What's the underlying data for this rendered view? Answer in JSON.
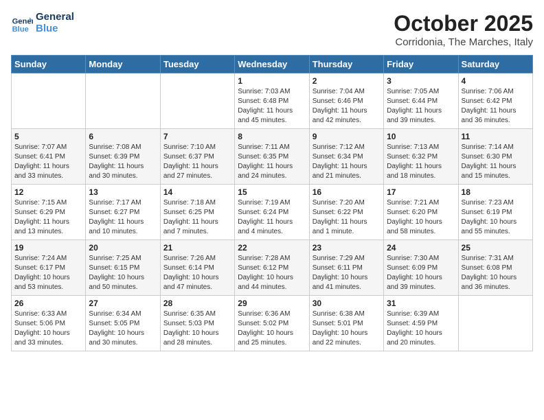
{
  "header": {
    "logo_line1": "General",
    "logo_line2": "Blue",
    "month_title": "October 2025",
    "location": "Corridonia, The Marches, Italy"
  },
  "days_of_week": [
    "Sunday",
    "Monday",
    "Tuesday",
    "Wednesday",
    "Thursday",
    "Friday",
    "Saturday"
  ],
  "weeks": [
    [
      {
        "day": "",
        "info": ""
      },
      {
        "day": "",
        "info": ""
      },
      {
        "day": "",
        "info": ""
      },
      {
        "day": "1",
        "info": "Sunrise: 7:03 AM\nSunset: 6:48 PM\nDaylight: 11 hours\nand 45 minutes."
      },
      {
        "day": "2",
        "info": "Sunrise: 7:04 AM\nSunset: 6:46 PM\nDaylight: 11 hours\nand 42 minutes."
      },
      {
        "day": "3",
        "info": "Sunrise: 7:05 AM\nSunset: 6:44 PM\nDaylight: 11 hours\nand 39 minutes."
      },
      {
        "day": "4",
        "info": "Sunrise: 7:06 AM\nSunset: 6:42 PM\nDaylight: 11 hours\nand 36 minutes."
      }
    ],
    [
      {
        "day": "5",
        "info": "Sunrise: 7:07 AM\nSunset: 6:41 PM\nDaylight: 11 hours\nand 33 minutes."
      },
      {
        "day": "6",
        "info": "Sunrise: 7:08 AM\nSunset: 6:39 PM\nDaylight: 11 hours\nand 30 minutes."
      },
      {
        "day": "7",
        "info": "Sunrise: 7:10 AM\nSunset: 6:37 PM\nDaylight: 11 hours\nand 27 minutes."
      },
      {
        "day": "8",
        "info": "Sunrise: 7:11 AM\nSunset: 6:35 PM\nDaylight: 11 hours\nand 24 minutes."
      },
      {
        "day": "9",
        "info": "Sunrise: 7:12 AM\nSunset: 6:34 PM\nDaylight: 11 hours\nand 21 minutes."
      },
      {
        "day": "10",
        "info": "Sunrise: 7:13 AM\nSunset: 6:32 PM\nDaylight: 11 hours\nand 18 minutes."
      },
      {
        "day": "11",
        "info": "Sunrise: 7:14 AM\nSunset: 6:30 PM\nDaylight: 11 hours\nand 15 minutes."
      }
    ],
    [
      {
        "day": "12",
        "info": "Sunrise: 7:15 AM\nSunset: 6:29 PM\nDaylight: 11 hours\nand 13 minutes."
      },
      {
        "day": "13",
        "info": "Sunrise: 7:17 AM\nSunset: 6:27 PM\nDaylight: 11 hours\nand 10 minutes."
      },
      {
        "day": "14",
        "info": "Sunrise: 7:18 AM\nSunset: 6:25 PM\nDaylight: 11 hours\nand 7 minutes."
      },
      {
        "day": "15",
        "info": "Sunrise: 7:19 AM\nSunset: 6:24 PM\nDaylight: 11 hours\nand 4 minutes."
      },
      {
        "day": "16",
        "info": "Sunrise: 7:20 AM\nSunset: 6:22 PM\nDaylight: 11 hours\nand 1 minute."
      },
      {
        "day": "17",
        "info": "Sunrise: 7:21 AM\nSunset: 6:20 PM\nDaylight: 10 hours\nand 58 minutes."
      },
      {
        "day": "18",
        "info": "Sunrise: 7:23 AM\nSunset: 6:19 PM\nDaylight: 10 hours\nand 55 minutes."
      }
    ],
    [
      {
        "day": "19",
        "info": "Sunrise: 7:24 AM\nSunset: 6:17 PM\nDaylight: 10 hours\nand 53 minutes."
      },
      {
        "day": "20",
        "info": "Sunrise: 7:25 AM\nSunset: 6:15 PM\nDaylight: 10 hours\nand 50 minutes."
      },
      {
        "day": "21",
        "info": "Sunrise: 7:26 AM\nSunset: 6:14 PM\nDaylight: 10 hours\nand 47 minutes."
      },
      {
        "day": "22",
        "info": "Sunrise: 7:28 AM\nSunset: 6:12 PM\nDaylight: 10 hours\nand 44 minutes."
      },
      {
        "day": "23",
        "info": "Sunrise: 7:29 AM\nSunset: 6:11 PM\nDaylight: 10 hours\nand 41 minutes."
      },
      {
        "day": "24",
        "info": "Sunrise: 7:30 AM\nSunset: 6:09 PM\nDaylight: 10 hours\nand 39 minutes."
      },
      {
        "day": "25",
        "info": "Sunrise: 7:31 AM\nSunset: 6:08 PM\nDaylight: 10 hours\nand 36 minutes."
      }
    ],
    [
      {
        "day": "26",
        "info": "Sunrise: 6:33 AM\nSunset: 5:06 PM\nDaylight: 10 hours\nand 33 minutes."
      },
      {
        "day": "27",
        "info": "Sunrise: 6:34 AM\nSunset: 5:05 PM\nDaylight: 10 hours\nand 30 minutes."
      },
      {
        "day": "28",
        "info": "Sunrise: 6:35 AM\nSunset: 5:03 PM\nDaylight: 10 hours\nand 28 minutes."
      },
      {
        "day": "29",
        "info": "Sunrise: 6:36 AM\nSunset: 5:02 PM\nDaylight: 10 hours\nand 25 minutes."
      },
      {
        "day": "30",
        "info": "Sunrise: 6:38 AM\nSunset: 5:01 PM\nDaylight: 10 hours\nand 22 minutes."
      },
      {
        "day": "31",
        "info": "Sunrise: 6:39 AM\nSunset: 4:59 PM\nDaylight: 10 hours\nand 20 minutes."
      },
      {
        "day": "",
        "info": ""
      }
    ]
  ]
}
